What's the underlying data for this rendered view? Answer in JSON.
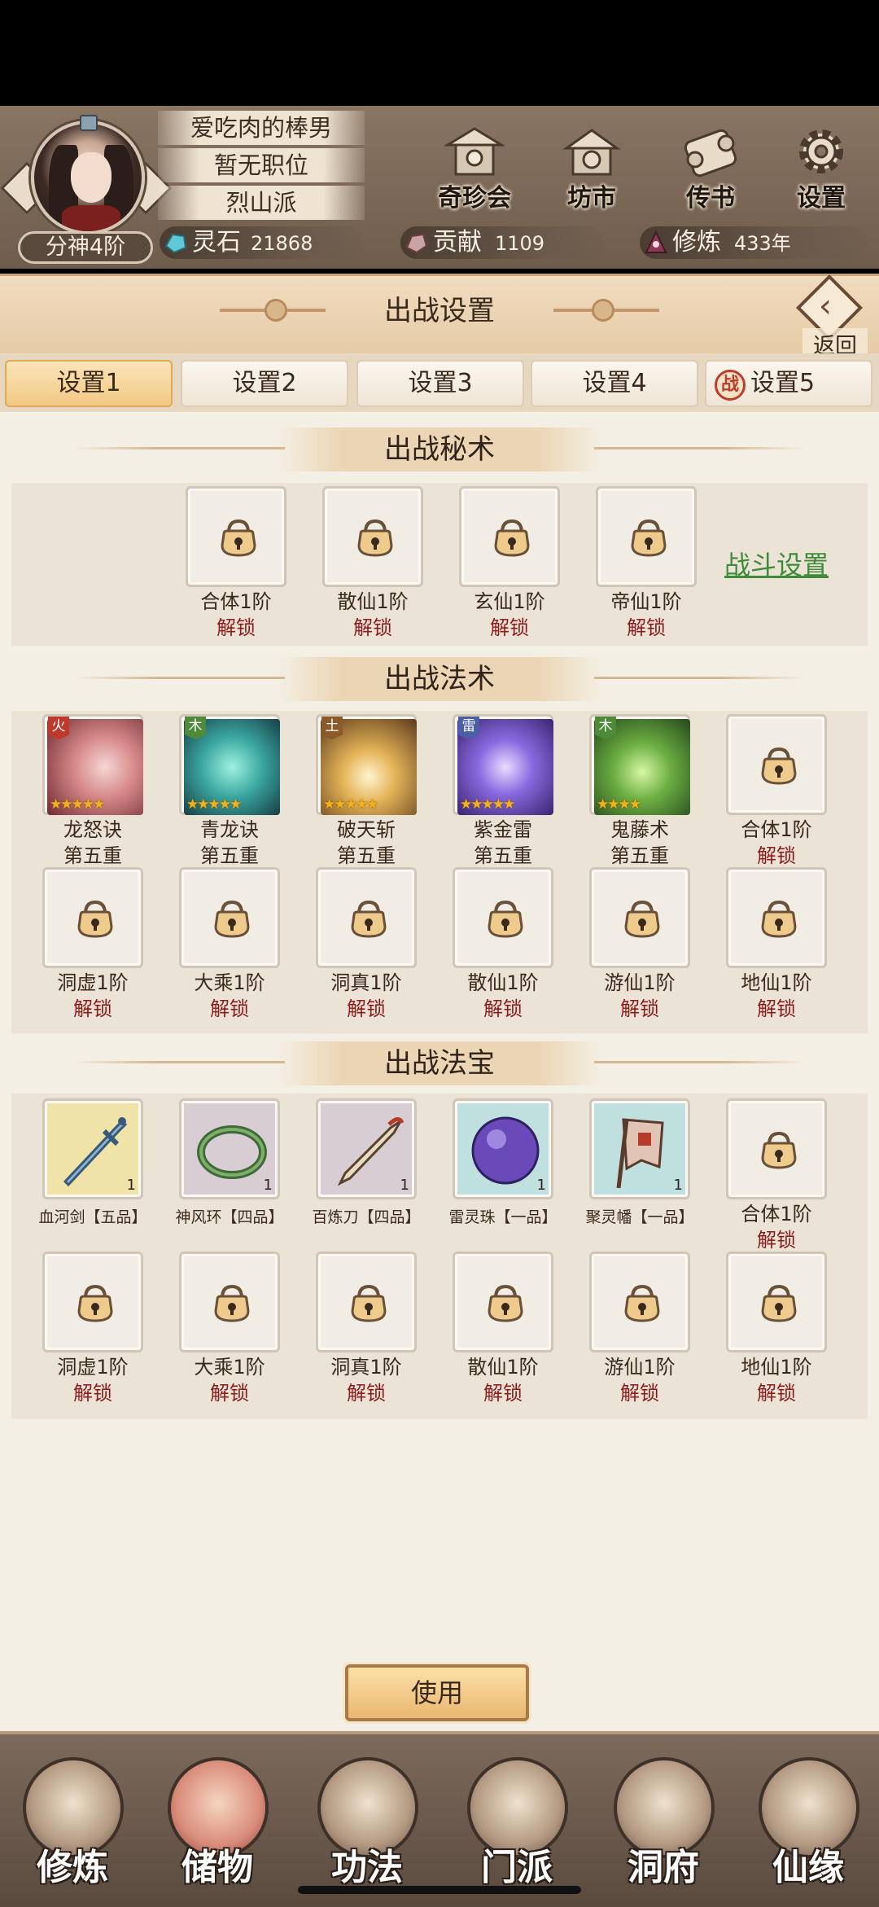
{
  "player": {
    "name": "爱吃肉的棒男",
    "title": "暂无职位",
    "sect": "烈山派",
    "rank": "分神4阶"
  },
  "top_buttons": {
    "qizhenhui": "奇珍会",
    "fangshi": "坊市",
    "chuanshu": "传书",
    "shezhi": "设置"
  },
  "resources": {
    "lingshi": {
      "name": "灵石",
      "value": "21868"
    },
    "gongxian": {
      "name": "贡献",
      "value": "1109"
    },
    "xiulian": {
      "name": "修炼",
      "value": "433年"
    }
  },
  "panel": {
    "title": "出战设置",
    "back_label": "返回",
    "tabs": [
      "设置1",
      "设置2",
      "设置3",
      "设置4",
      "设置5"
    ],
    "tab5_badge": "战",
    "battle_settings_link": "战斗设置",
    "use_button": "使用"
  },
  "sections": {
    "secret_arts": {
      "title": "出战秘术",
      "slots": [
        {
          "name": "合体1阶",
          "status": "解锁"
        },
        {
          "name": "散仙1阶",
          "status": "解锁"
        },
        {
          "name": "玄仙1阶",
          "status": "解锁"
        },
        {
          "name": "帝仙1阶",
          "status": "解锁"
        }
      ]
    },
    "spells": {
      "title": "出战法术",
      "equipped": [
        {
          "name": "龙怒诀",
          "level": "第五重",
          "element": "火",
          "element_color": "#c0392b",
          "stars": 5
        },
        {
          "name": "青龙诀",
          "level": "第五重",
          "element": "木",
          "element_color": "#4e8a3a",
          "stars": 5
        },
        {
          "name": "破天斩",
          "level": "第五重",
          "element": "土",
          "element_color": "#8a5a2a",
          "stars": 5
        },
        {
          "name": "紫金雷",
          "level": "第五重",
          "element": "雷",
          "element_color": "#4a5fa8",
          "stars": 5
        },
        {
          "name": "鬼藤术",
          "level": "第五重",
          "element": "木",
          "element_color": "#4e8a3a",
          "stars": 4
        }
      ],
      "locked": [
        {
          "name": "合体1阶",
          "status": "解锁"
        },
        {
          "name": "洞虚1阶",
          "status": "解锁"
        },
        {
          "name": "大乘1阶",
          "status": "解锁"
        },
        {
          "name": "洞真1阶",
          "status": "解锁"
        },
        {
          "name": "散仙1阶",
          "status": "解锁"
        },
        {
          "name": "游仙1阶",
          "status": "解锁"
        },
        {
          "name": "地仙1阶",
          "status": "解锁"
        }
      ]
    },
    "treasures": {
      "title": "出战法宝",
      "equipped": [
        {
          "name": "血河剑【五品】",
          "count": "1",
          "bg": "#efe3a8"
        },
        {
          "name": "神风环【四品】",
          "count": "1",
          "bg": "#d8cdd2"
        },
        {
          "name": "百炼刀【四品】",
          "count": "1",
          "bg": "#d8cdd2"
        },
        {
          "name": "雷灵珠【一品】",
          "count": "1",
          "bg": "#bfe0de"
        },
        {
          "name": "聚灵幡【一品】",
          "count": "1",
          "bg": "#bfe0de"
        }
      ],
      "locked": [
        {
          "name": "合体1阶",
          "status": "解锁"
        },
        {
          "name": "洞虚1阶",
          "status": "解锁"
        },
        {
          "name": "大乘1阶",
          "status": "解锁"
        },
        {
          "name": "洞真1阶",
          "status": "解锁"
        },
        {
          "name": "散仙1阶",
          "status": "解锁"
        },
        {
          "name": "游仙1阶",
          "status": "解锁"
        },
        {
          "name": "地仙1阶",
          "status": "解锁"
        }
      ]
    }
  },
  "bottom_nav": [
    "修炼",
    "储物",
    "功法",
    "门派",
    "洞府",
    "仙缘"
  ],
  "bottom_nav_active": "储物"
}
